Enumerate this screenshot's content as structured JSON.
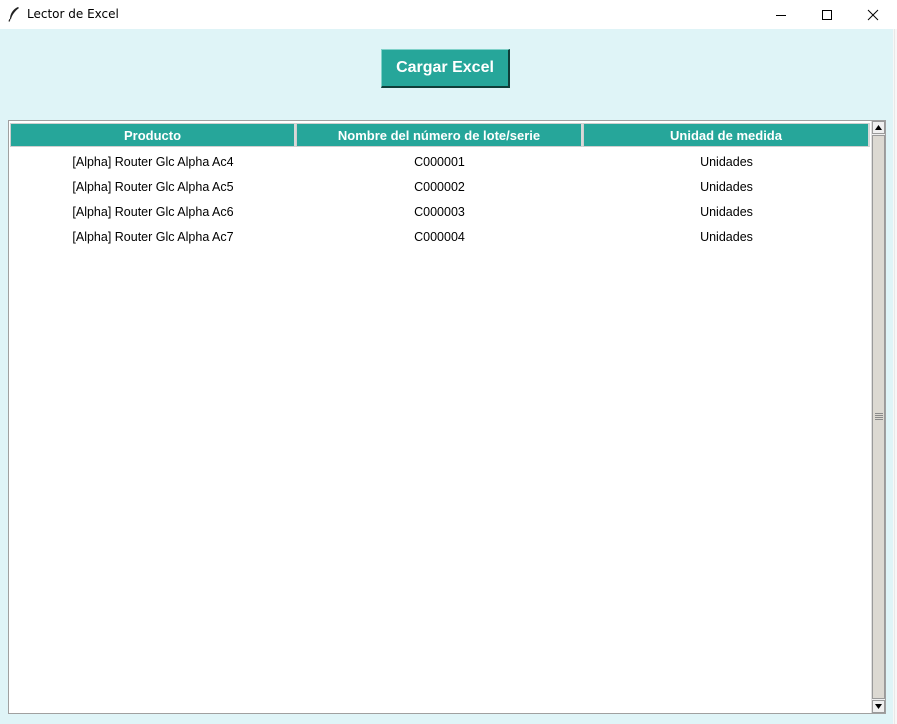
{
  "window": {
    "title": "Lector de Excel"
  },
  "icons": {
    "app": "feather-icon",
    "minimize": "minimize-icon",
    "maximize": "maximize-icon",
    "close": "close-icon"
  },
  "toolbar": {
    "load_label": "Cargar Excel"
  },
  "table": {
    "columns": [
      "Producto",
      "Nombre del número de lote/serie",
      "Unidad de medida"
    ],
    "rows": [
      [
        "[Alpha] Router Glc Alpha Ac4",
        "C000001",
        "Unidades"
      ],
      [
        "[Alpha] Router Glc Alpha Ac5",
        "C000002",
        "Unidades"
      ],
      [
        "[Alpha] Router Glc Alpha Ac6",
        "C000003",
        "Unidades"
      ],
      [
        "[Alpha] Router Glc Alpha Ac7",
        "C000004",
        "Unidades"
      ]
    ]
  },
  "colors": {
    "accent": "#26a69a",
    "background": "#dff4f7",
    "header_text": "#ffffff"
  }
}
